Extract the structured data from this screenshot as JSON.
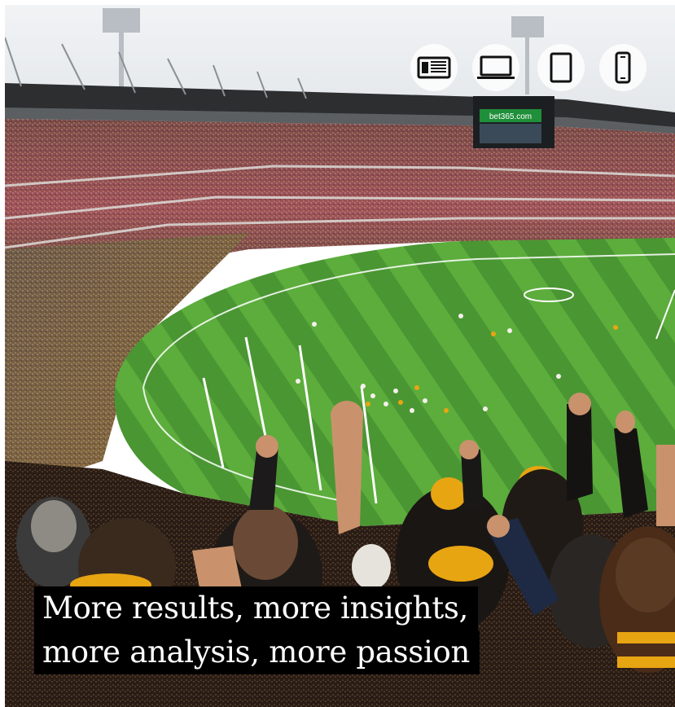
{
  "caption": {
    "line1": "More results, more insights,",
    "line2": "more analysis, more passion"
  },
  "devices": [
    {
      "icon": "newspaper-icon"
    },
    {
      "icon": "laptop-icon"
    },
    {
      "icon": "tablet-icon"
    },
    {
      "icon": "phone-icon"
    }
  ],
  "scoreboard": {
    "text": "bet365.com"
  },
  "colors": {
    "sky": "#e9ecef",
    "grass_dark": "#3f8b2c",
    "grass_light": "#5aa83a",
    "team_gold": "#e8a512",
    "team_brown": "#4a2c18",
    "caption_bg": "#000000",
    "caption_text": "#ffffff"
  }
}
